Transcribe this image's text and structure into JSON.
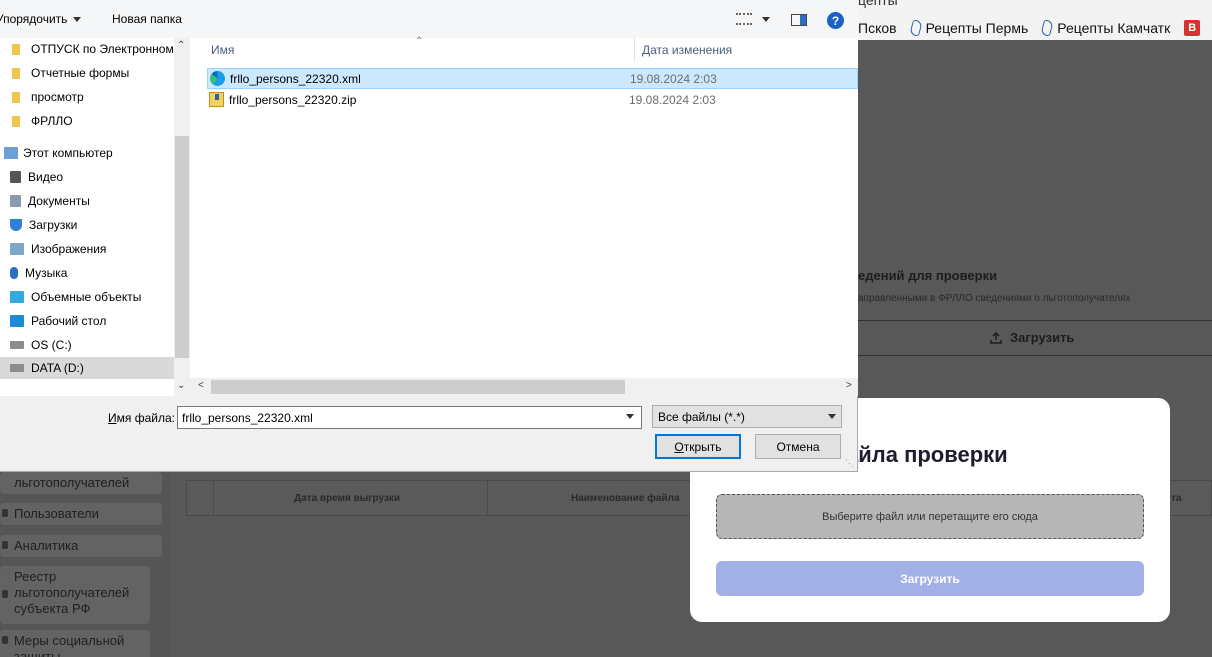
{
  "browser": {
    "tab_title_fragment": "цепты",
    "bookmarks": [
      {
        "label": "Псков",
        "icon": "feather-bookmark-icon"
      },
      {
        "label": "Рецепты Пермь",
        "icon": "feather-bookmark-icon"
      },
      {
        "label": "Рецепты Камчатк",
        "icon": "feather-bookmark-icon"
      },
      {
        "label": "В",
        "icon": "red-square-bookmark-icon"
      }
    ]
  },
  "app": {
    "sidebar": [
      {
        "label": "льготополучателей"
      },
      {
        "label": "Пользователи"
      },
      {
        "label": "Аналитика"
      },
      {
        "label": "Реестр льготополучателей субъекта РФ"
      },
      {
        "label": "Меры социальной защиты"
      }
    ],
    "check_panel": {
      "title": "едений для проверки",
      "subtitle": "аправленными в ФРЛЛО сведениями о льготополучателях",
      "upload_label": "Загрузить"
    },
    "table_headers": [
      "Дата время выгрузки",
      "Наименование файла",
      "та"
    ],
    "modal": {
      "title": "айла проверки",
      "dropzone_link": "Выберите файл",
      "dropzone_rest": "или перетащите его сюда",
      "upload_button": "Загрузить"
    }
  },
  "dialog": {
    "toolbar": {
      "organize_label": "Упорядочить",
      "new_folder_label": "Новая папка",
      "help_label": "?"
    },
    "nav_items": [
      {
        "label": "ОТПУСК по Электронном",
        "icon": "folder-icon"
      },
      {
        "label": "Отчетные формы",
        "icon": "folder-icon"
      },
      {
        "label": "просмотр",
        "icon": "folder-icon"
      },
      {
        "label": "ФРЛЛО",
        "icon": "folder-icon"
      },
      {
        "label": "Этот компьютер",
        "icon": "computer-icon"
      },
      {
        "label": "Видео",
        "icon": "video-icon"
      },
      {
        "label": "Документы",
        "icon": "documents-icon"
      },
      {
        "label": "Загрузки",
        "icon": "download-icon"
      },
      {
        "label": "Изображения",
        "icon": "pictures-icon"
      },
      {
        "label": "Музыка",
        "icon": "music-icon"
      },
      {
        "label": "Объемные объекты",
        "icon": "3d-objects-icon"
      },
      {
        "label": "Рабочий стол",
        "icon": "desktop-icon"
      },
      {
        "label": "OS (C:)",
        "icon": "drive-icon"
      },
      {
        "label": "DATA (D:)",
        "icon": "drive-icon",
        "selected": true
      }
    ],
    "columns": {
      "name": "Имя",
      "date": "Дата изменения"
    },
    "files": [
      {
        "name": "frllo_persons_22320.xml",
        "date": "19.08.2024 2:03",
        "icon": "edge-xml-icon",
        "selected": true
      },
      {
        "name": "frllo_persons_22320.zip",
        "date": "19.08.2024 2:03",
        "icon": "zip-icon",
        "selected": false
      }
    ],
    "filename_label_underlined": "И",
    "filename_label_rest": "мя файла:",
    "filename_value": "frllo_persons_22320.xml",
    "file_type": "Все файлы (*.*)",
    "open_underlined": "О",
    "open_rest": "ткрыть",
    "cancel_label": "Отмена"
  }
}
